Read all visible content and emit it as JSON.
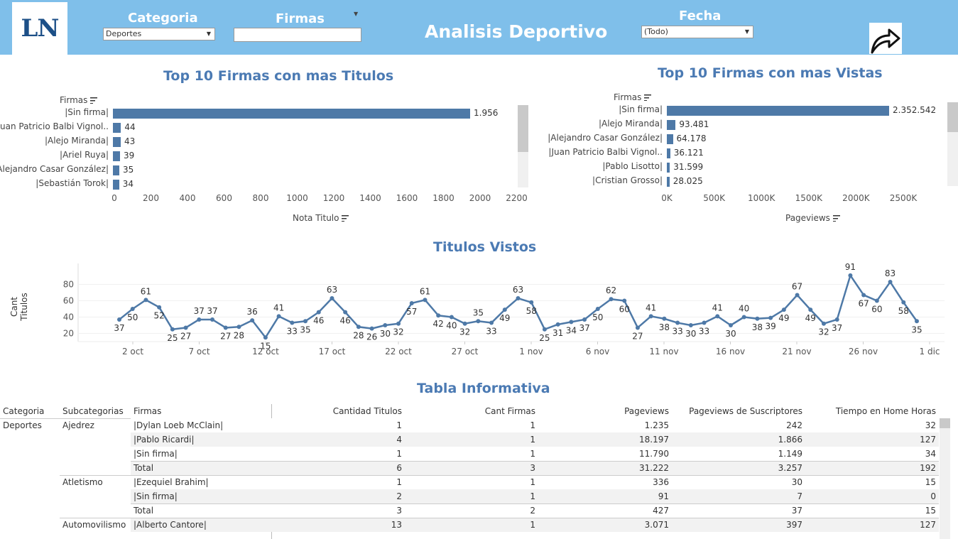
{
  "header": {
    "logo": "LN",
    "categoria_label": "Categoria",
    "categoria_value": "Deportes",
    "firmas_label": "Firmas",
    "firmas_value": "",
    "title": "Analisis Deportivo",
    "fecha_label": "Fecha",
    "fecha_value": "(Todo)"
  },
  "top_titulos": {
    "title": "Top 10 Firmas con mas Titulos",
    "row_header": "Firmas",
    "axis_label": "Nota Titulo",
    "rows": [
      {
        "name": "|Sin firma|",
        "value": 1956,
        "label": "1.956"
      },
      {
        "name": "|Juan Patricio Balbi Vignol..",
        "value": 44,
        "label": "44"
      },
      {
        "name": "|Alejo Miranda|",
        "value": 43,
        "label": "43"
      },
      {
        "name": "|Ariel Ruya|",
        "value": 39,
        "label": "39"
      },
      {
        "name": "|Alejandro Casar González|",
        "value": 35,
        "label": "35"
      },
      {
        "name": "|Sebastián Torok|",
        "value": 34,
        "label": "34"
      }
    ],
    "ticks": [
      "0",
      "200",
      "400",
      "600",
      "800",
      "1000",
      "1200",
      "1400",
      "1600",
      "1800",
      "2000",
      "2200"
    ]
  },
  "top_vistas": {
    "title": "Top 10 Firmas con mas Vistas",
    "row_header": "Firmas",
    "axis_label": "Pageviews",
    "rows": [
      {
        "name": "|Sin firma|",
        "value": 2352542,
        "label": "2.352.542"
      },
      {
        "name": "|Alejo Miranda|",
        "value": 93481,
        "label": "93.481"
      },
      {
        "name": "|Alejandro Casar González|",
        "value": 64178,
        "label": "64.178"
      },
      {
        "name": "|Juan Patricio Balbi Vignol..",
        "value": 36121,
        "label": "36.121"
      },
      {
        "name": "|Pablo Lisotto|",
        "value": 31599,
        "label": "31.599"
      },
      {
        "name": "|Cristian Grosso|",
        "value": 28025,
        "label": "28.025"
      }
    ],
    "ticks": [
      "0K",
      "500K",
      "1000K",
      "1500K",
      "2000K",
      "2500K"
    ]
  },
  "chart_data": {
    "type": "line",
    "title": "Titulos Vistos",
    "ylabel": "Cant Titulos",
    "xlabel": "",
    "ylim": [
      10,
      90
    ],
    "yticks": [
      "20",
      "40",
      "60",
      "80"
    ],
    "xticks": [
      "2 oct",
      "7 oct",
      "12 oct",
      "17 oct",
      "22 oct",
      "27 oct",
      "1 nov",
      "6 nov",
      "11 nov",
      "16 nov",
      "21 nov",
      "26 nov",
      "1 dic"
    ],
    "values": [
      37,
      50,
      61,
      52,
      25,
      27,
      37,
      37,
      27,
      28,
      36,
      15,
      41,
      33,
      35,
      46,
      63,
      46,
      28,
      26,
      30,
      32,
      57,
      61,
      42,
      40,
      32,
      35,
      33,
      49,
      63,
      58,
      25,
      31,
      34,
      37,
      50,
      62,
      60,
      27,
      41,
      38,
      33,
      30,
      33,
      41,
      30,
      40,
      38,
      39,
      49,
      67,
      49,
      32,
      37,
      91,
      67,
      60,
      83,
      58,
      35
    ]
  },
  "table": {
    "title": "Tabla Informativa",
    "columns": [
      "Categoria",
      "Subcategorias",
      "Firmas",
      "Cantidad Titulos",
      "Cant Firmas",
      "Pageviews",
      "Pageviews de Suscriptores",
      "Tiempo en Home Horas"
    ],
    "rows": [
      {
        "cat": "Deportes",
        "sub": "Ajedrez",
        "firma": "|Dylan Loeb McClain|",
        "titulos": "1",
        "firmas": "1",
        "pv": "1.235",
        "pvs": "242",
        "th": "32",
        "shade": false
      },
      {
        "cat": "",
        "sub": "",
        "firma": "|Pablo Ricardi|",
        "titulos": "4",
        "firmas": "1",
        "pv": "18.197",
        "pvs": "1.866",
        "th": "127",
        "shade": true
      },
      {
        "cat": "",
        "sub": "",
        "firma": "|Sin firma|",
        "titulos": "1",
        "firmas": "1",
        "pv": "11.790",
        "pvs": "1.149",
        "th": "34",
        "shade": false
      },
      {
        "cat": "",
        "sub": "",
        "firma": "Total",
        "titulos": "6",
        "firmas": "3",
        "pv": "31.222",
        "pvs": "3.257",
        "th": "192",
        "shade": true
      },
      {
        "cat": "",
        "sub": "Atletismo",
        "firma": "|Ezequiel Brahim|",
        "titulos": "1",
        "firmas": "1",
        "pv": "336",
        "pvs": "30",
        "th": "15",
        "shade": false
      },
      {
        "cat": "",
        "sub": "",
        "firma": "|Sin firma|",
        "titulos": "2",
        "firmas": "1",
        "pv": "91",
        "pvs": "7",
        "th": "0",
        "shade": true
      },
      {
        "cat": "",
        "sub": "",
        "firma": "Total",
        "titulos": "3",
        "firmas": "2",
        "pv": "427",
        "pvs": "37",
        "th": "15",
        "shade": false
      },
      {
        "cat": "",
        "sub": "Automovilismo",
        "firma": "|Alberto Cantore|",
        "titulos": "13",
        "firmas": "1",
        "pv": "3.071",
        "pvs": "397",
        "th": "127",
        "shade": true
      }
    ]
  },
  "colors": {
    "header_bg": "#7fbfea",
    "bar": "#4e79a7",
    "title": "#4b7ab3"
  }
}
